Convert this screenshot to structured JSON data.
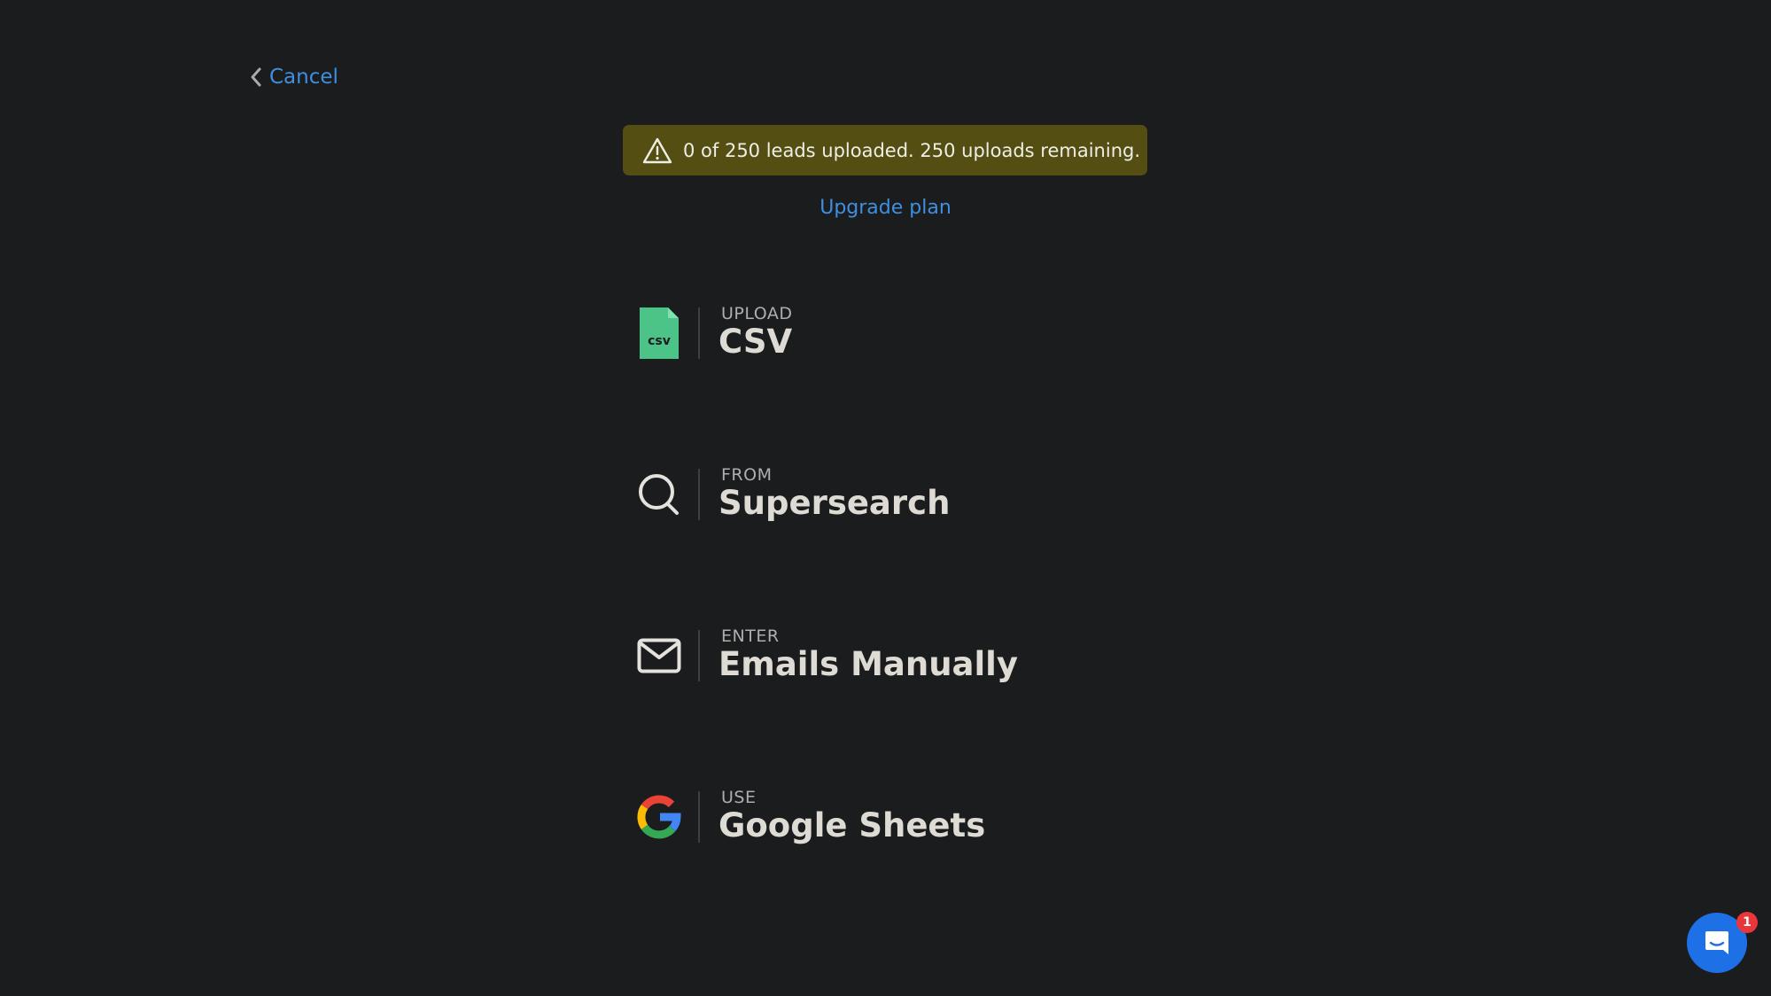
{
  "nav": {
    "cancel_label": "Cancel"
  },
  "banner": {
    "message": "0 of 250 leads uploaded.  250 uploads remaining.",
    "icon": "warning-triangle-icon",
    "background": "#544e12"
  },
  "upgrade": {
    "label": "Upgrade plan"
  },
  "options": [
    {
      "icon": "csv-file-icon",
      "sub": "UPLOAD",
      "main": "CSV"
    },
    {
      "icon": "search-icon",
      "sub": "FROM",
      "main": "Supersearch"
    },
    {
      "icon": "mail-icon",
      "sub": "ENTER",
      "main": "Emails Manually"
    },
    {
      "icon": "google-icon",
      "sub": "USE",
      "main": "Google Sheets"
    }
  ],
  "chat": {
    "icon": "chat-icon",
    "badge_count": "1"
  },
  "colors": {
    "background": "#1b1c1e",
    "link": "#3f8fe0",
    "csv_green": "#4cc488",
    "chat_blue": "#1d70e6",
    "badge_red": "#e8363a"
  }
}
